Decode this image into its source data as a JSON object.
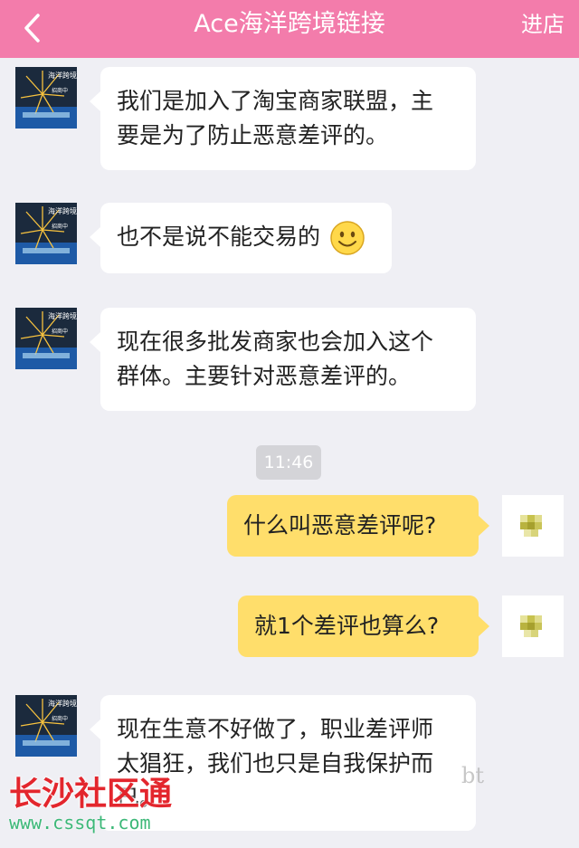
{
  "header": {
    "title": "Ace海洋跨境链接",
    "store_label": "进店",
    "background": "#f37cab"
  },
  "messages": [
    {
      "side": "left",
      "text_lines": [
        "我们是加入了淘宝商家联盟，主",
        "要是为了防止恶意差评的。"
      ]
    },
    {
      "side": "left",
      "text_lines": [
        "也不是说不能交易的"
      ],
      "emoji": "smiley-emoji"
    },
    {
      "side": "left",
      "text_lines": [
        "现在很多批发商家也会加入这个",
        "群体。主要针对恶意差评的。"
      ]
    },
    {
      "side": "right",
      "text_lines": [
        "什么叫恶意差评呢?"
      ]
    },
    {
      "side": "right",
      "text_lines": [
        "就1个差评也算么?"
      ]
    },
    {
      "side": "left",
      "text_lines": [
        "现在生意不好做了，职业差评师",
        "太猖狂，我们也只是自我保护而",
        "已。"
      ]
    }
  ],
  "timestamp": "11:46",
  "avatar_text": {
    "line1": "海洋跨境",
    "line2": "招商中"
  },
  "watermark": {
    "name": "长沙社区通",
    "url": "www.cssqt.com",
    "faint": "bt"
  },
  "colors": {
    "incoming_bubble": "#ffffff",
    "outgoing_bubble": "#ffde6b",
    "background": "#efeff4"
  }
}
